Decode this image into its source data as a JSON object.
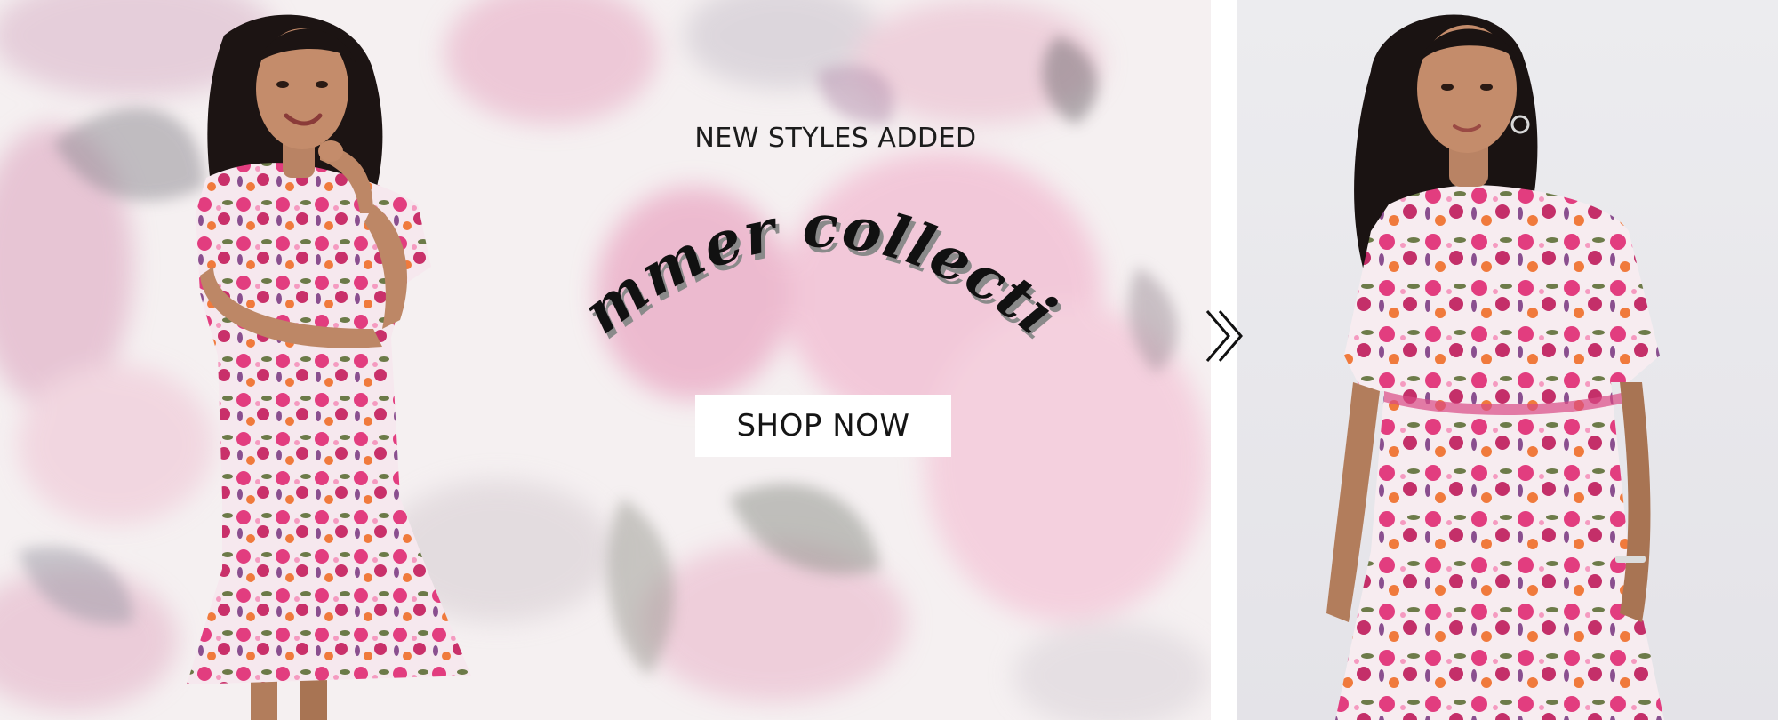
{
  "banner": {
    "headline": "NEW STYLES ADDED",
    "title": "Summer collection",
    "cta_label": "SHOP NOW",
    "next_icon": "double-chevron-right-icon"
  },
  "colors": {
    "text_dark": "#151515",
    "button_bg": "#ffffff",
    "watercolor_pink": "#e07aa5",
    "watercolor_gray": "#9a969e",
    "dress_pink": "#e23d7f",
    "right_bg": "#e8e7eb"
  },
  "images": {
    "left_model": "model-in-floral-dress-image",
    "right_model": "model-in-floral-dress-closeup-image"
  }
}
